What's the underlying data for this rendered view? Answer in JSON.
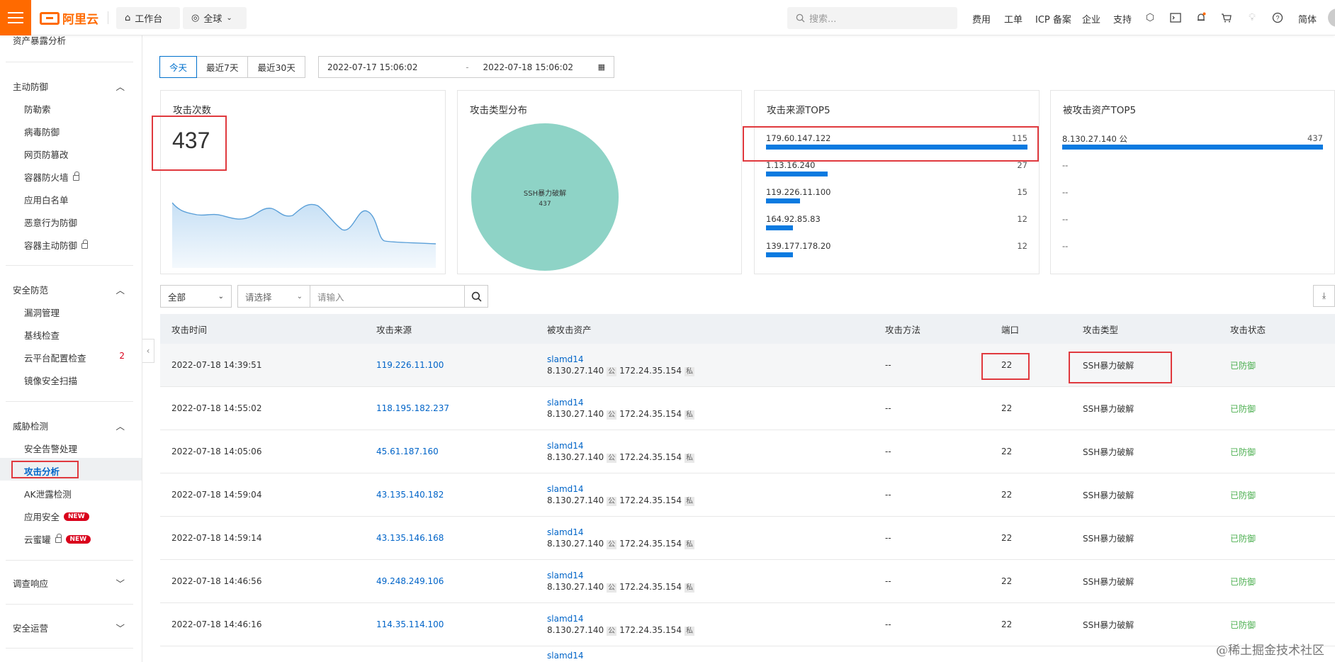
{
  "topbar": {
    "logo": "阿里云",
    "workbench": "工作台",
    "region": "全球",
    "search_placeholder": "搜索...",
    "links": [
      "费用",
      "工单",
      "ICP 备案",
      "企业",
      "支持"
    ],
    "lang": "简体",
    "icons": [
      "app-icon",
      "terminal-icon",
      "bell-icon",
      "cart-icon",
      "lightbulb-icon",
      "help-icon"
    ]
  },
  "sidebar": {
    "top_item": "资产暴露分析",
    "groups": [
      {
        "title": "主动防御",
        "expanded": true,
        "items": [
          "防勒索",
          "病毒防御",
          "网页防篡改",
          "容器防火墙",
          "应用白名单",
          "恶意行为防御",
          "容器主动防御"
        ]
      },
      {
        "title": "安全防范",
        "expanded": true,
        "items": [
          "漏洞管理",
          "基线检查",
          "云平台配置检查",
          "镜像安全扫描"
        ],
        "badge_count": "2"
      },
      {
        "title": "威胁检测",
        "expanded": true,
        "items": [
          "安全告警处理",
          "攻击分析",
          "AK泄露检测",
          "应用安全",
          "云蜜罐"
        ],
        "active": "攻击分析",
        "new_badge": "NEW"
      },
      {
        "title": "调查响应",
        "expanded": false
      },
      {
        "title": "安全运营",
        "expanded": false
      }
    ]
  },
  "date_filter": {
    "buttons": [
      "今天",
      "最近7天",
      "最近30天"
    ],
    "active": "今天",
    "start": "2022-07-17 15:06:02",
    "sep": "-",
    "end": "2022-07-18 15:06:02"
  },
  "cards": {
    "attack_count": {
      "title": "攻击次数",
      "value": "437"
    },
    "type_dist": {
      "title": "攻击类型分布",
      "slice_label": "SSH暴力破解",
      "slice_value": "437",
      "color": "#8ed3c6"
    },
    "source_top5": {
      "title": "攻击来源TOP5",
      "rows": [
        {
          "ip": "179.60.147.122",
          "count": "115",
          "fraction": 1.0
        },
        {
          "ip": "1.13.16.240",
          "count": "27",
          "fraction": 0.235
        },
        {
          "ip": "119.226.11.100",
          "count": "15",
          "fraction": 0.13
        },
        {
          "ip": "164.92.85.83",
          "count": "12",
          "fraction": 0.104
        },
        {
          "ip": "139.177.178.20",
          "count": "12",
          "fraction": 0.104
        }
      ]
    },
    "asset_top5": {
      "title": "被攻击资产TOP5",
      "rows": [
        {
          "ip": "8.130.27.140 公",
          "count": "437",
          "fraction": 1.0
        },
        {
          "ip": "--"
        },
        {
          "ip": "--"
        },
        {
          "ip": "--"
        },
        {
          "ip": "--"
        }
      ]
    }
  },
  "filters": {
    "scope": "全部",
    "select_placeholder": "请选择",
    "input_placeholder": "请输入"
  },
  "table": {
    "headers": [
      "攻击时间",
      "攻击来源",
      "被攻击资产",
      "攻击方法",
      "端口",
      "攻击类型",
      "攻击状态"
    ],
    "rows": [
      {
        "time": "2022-07-18 14:39:51",
        "source": "119.226.11.100",
        "asset_name": "slamd14",
        "public_ip": "8.130.27.140",
        "public_tag": "公",
        "private_ip": "172.24.35.154",
        "private_tag": "私",
        "method": "--",
        "port": "22",
        "type": "SSH暴力破解",
        "status": "已防御"
      },
      {
        "time": "2022-07-18 14:55:02",
        "source": "118.195.182.237",
        "asset_name": "slamd14",
        "public_ip": "8.130.27.140",
        "public_tag": "公",
        "private_ip": "172.24.35.154",
        "private_tag": "私",
        "method": "--",
        "port": "22",
        "type": "SSH暴力破解",
        "status": "已防御"
      },
      {
        "time": "2022-07-18 14:05:06",
        "source": "45.61.187.160",
        "asset_name": "slamd14",
        "public_ip": "8.130.27.140",
        "public_tag": "公",
        "private_ip": "172.24.35.154",
        "private_tag": "私",
        "method": "--",
        "port": "22",
        "type": "SSH暴力破解",
        "status": "已防御"
      },
      {
        "time": "2022-07-18 14:59:04",
        "source": "43.135.140.182",
        "asset_name": "slamd14",
        "public_ip": "8.130.27.140",
        "public_tag": "公",
        "private_ip": "172.24.35.154",
        "private_tag": "私",
        "method": "--",
        "port": "22",
        "type": "SSH暴力破解",
        "status": "已防御"
      },
      {
        "time": "2022-07-18 14:59:14",
        "source": "43.135.146.168",
        "asset_name": "slamd14",
        "public_ip": "8.130.27.140",
        "public_tag": "公",
        "private_ip": "172.24.35.154",
        "private_tag": "私",
        "method": "--",
        "port": "22",
        "type": "SSH暴力破解",
        "status": "已防御"
      },
      {
        "time": "2022-07-18 14:46:56",
        "source": "49.248.249.106",
        "asset_name": "slamd14",
        "public_ip": "8.130.27.140",
        "public_tag": "公",
        "private_ip": "172.24.35.154",
        "private_tag": "私",
        "method": "--",
        "port": "22",
        "type": "SSH暴力破解",
        "status": "已防御"
      },
      {
        "time": "2022-07-18 14:46:16",
        "source": "114.35.114.100",
        "asset_name": "slamd14",
        "public_ip": "8.130.27.140",
        "public_tag": "公",
        "private_ip": "172.24.35.154",
        "private_tag": "私",
        "method": "--",
        "port": "22",
        "type": "SSH暴力破解",
        "status": "已防御"
      }
    ],
    "partial_row_asset": "slamd14"
  },
  "watermark": "@稀土掘金技术社区",
  "colors": {
    "brand": "#ff6a00",
    "link": "#0064c8",
    "bar": "#0a7ae0",
    "ok": "#4caf50",
    "highlight": "#e0393e"
  }
}
